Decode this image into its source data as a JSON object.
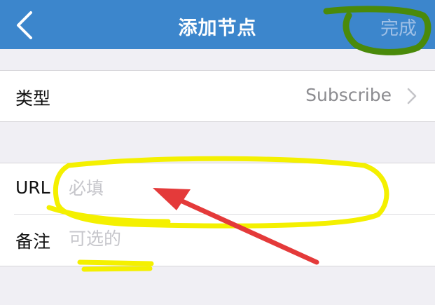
{
  "nav": {
    "title": "添加节点",
    "done_label": "完成"
  },
  "rows": {
    "type": {
      "label": "类型",
      "value": "Subscribe"
    },
    "url": {
      "label": "URL",
      "placeholder": "必填"
    },
    "note": {
      "label": "备注",
      "placeholder": "可选的"
    }
  },
  "colors": {
    "nav_bar": "#3c86cc",
    "background": "#f0eff4",
    "highlight_yellow": "#f4f000",
    "highlight_green": "#4a8a0a",
    "arrow_red": "#e43a3a"
  }
}
